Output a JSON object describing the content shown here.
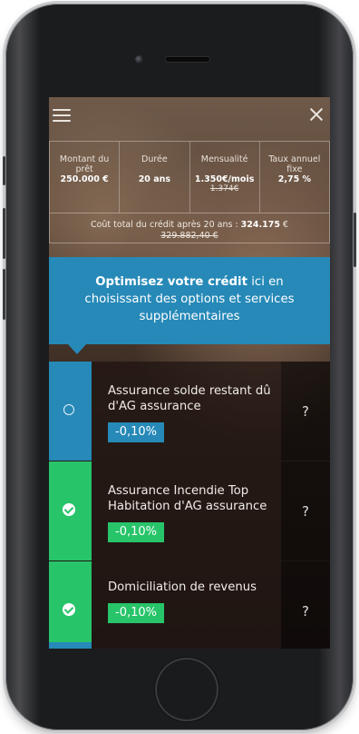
{
  "topbar": {
    "menu_icon": "hamburger-menu-icon",
    "close_icon": "close-icon"
  },
  "summary": {
    "columns": [
      {
        "label": "Montant du prêt",
        "value": "250.000 €",
        "old": ""
      },
      {
        "label": "Durée",
        "value": "20 ans",
        "old": ""
      },
      {
        "label": "Mensualité",
        "value": "1.350€/mois",
        "old": "1.374€"
      },
      {
        "label": "Taux annuel fixe",
        "value": "2,75 %",
        "old": ""
      }
    ],
    "total_prefix": "Coût total du crédit après 20 ans : ",
    "total_value": "324.175",
    "total_suffix": " €",
    "total_old": "329.882,40 €"
  },
  "bubble": {
    "bold": "Optimisez votre crédit",
    "text": " ici en choisissant des options et services supplémentaires"
  },
  "options": [
    {
      "title": "Assurance solde restant dû d'AG assurance",
      "badge": "-0,10%",
      "selected": false,
      "help": "?"
    },
    {
      "title": "Assurance Incendie Top Habitation d'AG assurance",
      "badge": "-0,10%",
      "selected": true,
      "help": "?"
    },
    {
      "title": "Domiciliation de revenus",
      "badge": "-0,10%",
      "selected": true,
      "help": "?"
    }
  ],
  "colors": {
    "accent_blue": "#2689b8",
    "accent_green": "#28c46a"
  }
}
